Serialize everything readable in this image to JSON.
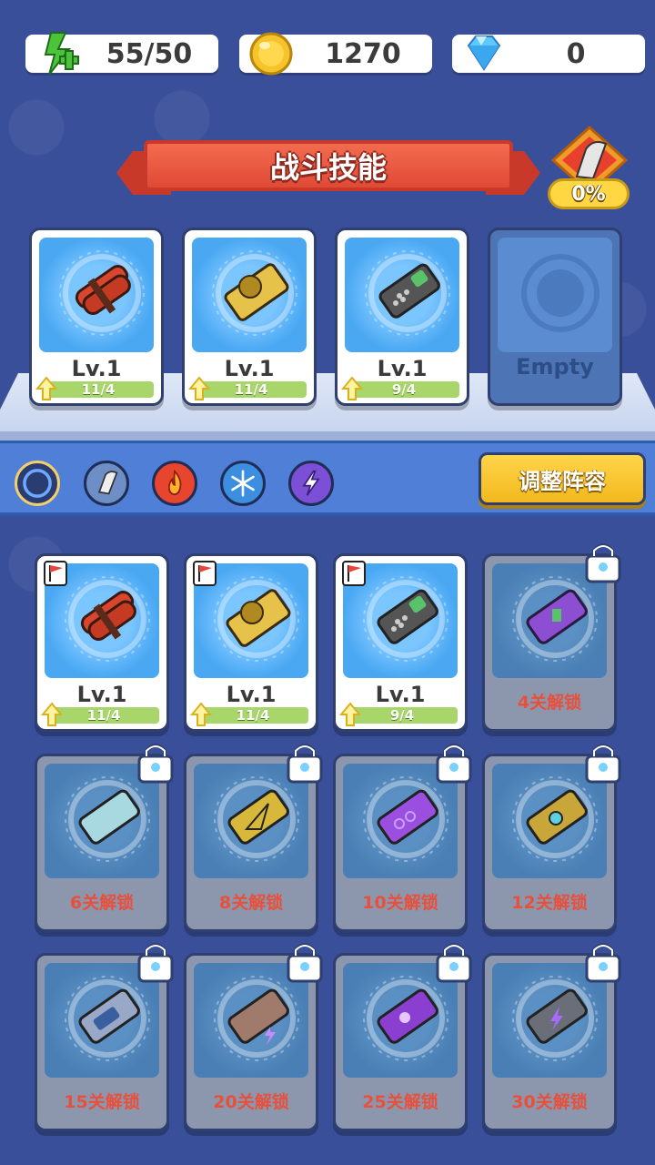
{
  "resources": {
    "energy": {
      "icon": "energy-plus-icon",
      "value": "55/50"
    },
    "coins": {
      "icon": "coin-icon",
      "value": "1270"
    },
    "gems": {
      "icon": "diamond-icon",
      "value": "0"
    }
  },
  "header": {
    "title": "战斗技能",
    "power_percent": "0%"
  },
  "equipped": [
    {
      "item": "dynamite",
      "level": "Lv.1",
      "progress": "11/4"
    },
    {
      "item": "saw-blade",
      "level": "Lv.1",
      "progress": "11/4"
    },
    {
      "item": "remote-control",
      "level": "Lv.1",
      "progress": "9/4"
    },
    {
      "label": "Empty"
    }
  ],
  "filters": [
    {
      "name": "all",
      "icon": "ring-icon",
      "selected": true
    },
    {
      "name": "blade",
      "icon": "blade-icon"
    },
    {
      "name": "fire",
      "icon": "fire-icon"
    },
    {
      "name": "ice",
      "icon": "snowflake-icon"
    },
    {
      "name": "lightning",
      "icon": "lightning-icon"
    }
  ],
  "adjust_button": "调整阵容",
  "inventory": [
    {
      "item": "dynamite",
      "level": "Lv.1",
      "progress": "11/4",
      "owned": true
    },
    {
      "item": "saw-blade",
      "level": "Lv.1",
      "progress": "11/4",
      "owned": true
    },
    {
      "item": "remote-control",
      "level": "Lv.1",
      "progress": "9/4",
      "owned": true
    },
    {
      "item": "purple-device",
      "unlock": "4关解锁"
    },
    {
      "item": "glass-tile",
      "unlock": "6关解锁"
    },
    {
      "item": "pyramid-tile",
      "unlock": "8关解锁"
    },
    {
      "item": "purple-tile",
      "unlock": "10关解锁"
    },
    {
      "item": "gold-device",
      "unlock": "12关解锁"
    },
    {
      "item": "battery",
      "unlock": "15关解锁"
    },
    {
      "item": "stone-slab",
      "unlock": "20关解锁"
    },
    {
      "item": "purple-orb-tile",
      "unlock": "25关解锁"
    },
    {
      "item": "lightning-tile",
      "unlock": "30关解锁"
    }
  ],
  "colors": {
    "background": "#3a4f9a",
    "banner": "#e04a36",
    "accent_yellow": "#f2b81d",
    "unlock_text": "#e8503c",
    "progress_green": "#a8d66a"
  }
}
